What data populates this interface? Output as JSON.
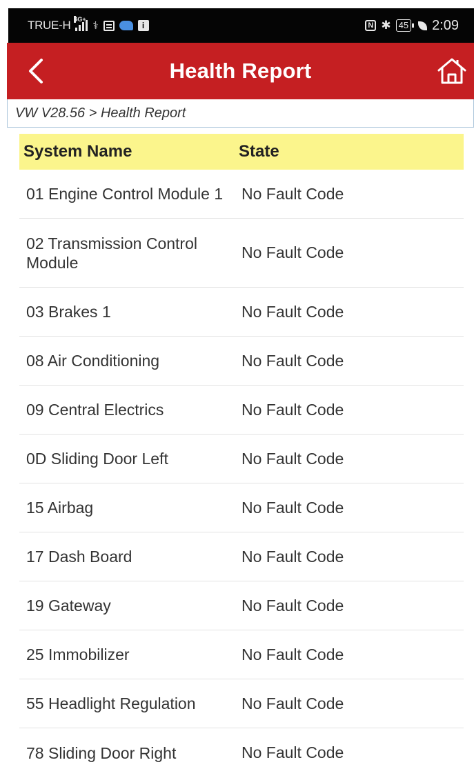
{
  "status_bar": {
    "carrier": "TRUE-H",
    "network": "4G+",
    "battery": "45",
    "time": "2:09"
  },
  "header": {
    "title": "Health Report",
    "color": "#c51f22"
  },
  "breadcrumb": {
    "text": "VW V28.56 > Health Report"
  },
  "table": {
    "header_color": "#fbf58c",
    "columns": [
      "System Name",
      "State"
    ],
    "rows": [
      {
        "name": "01 Engine Control Module 1",
        "state": "No Fault Code"
      },
      {
        "name": "02 Transmission Control Module",
        "state": "No Fault Code"
      },
      {
        "name": "03 Brakes 1",
        "state": "No Fault Code"
      },
      {
        "name": "08 Air Conditioning",
        "state": "No Fault Code"
      },
      {
        "name": "09 Central Electrics",
        "state": "No Fault Code"
      },
      {
        "name": "0D Sliding Door Left",
        "state": "No Fault Code"
      },
      {
        "name": "15 Airbag",
        "state": "No Fault Code"
      },
      {
        "name": "17 Dash Board",
        "state": "No Fault Code"
      },
      {
        "name": "19 Gateway",
        "state": "No Fault Code"
      },
      {
        "name": "25 Immobilizer",
        "state": "No Fault Code"
      },
      {
        "name": "55 Headlight Regulation",
        "state": "No Fault Code"
      },
      {
        "name": "78 Sliding Door Right",
        "state": "No Fault Code"
      }
    ]
  },
  "icons": {
    "back": "chevron-left-icon",
    "home": "home-icon"
  }
}
